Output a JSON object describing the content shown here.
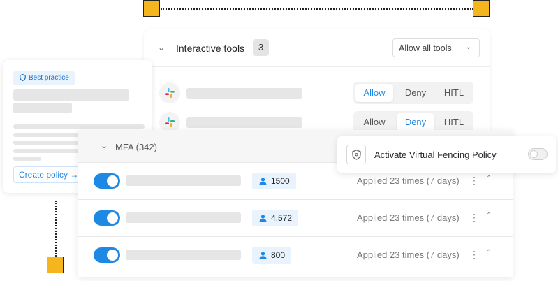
{
  "tools": {
    "title": "Interactive tools",
    "count": "3",
    "policy_select": "Allow all tools",
    "rows": [
      {
        "icon": "slack-icon",
        "options": [
          "Allow",
          "Deny",
          "HITL"
        ],
        "selected": "Allow"
      },
      {
        "icon": "slack-icon",
        "options": [
          "Allow",
          "Deny",
          "HITL"
        ],
        "selected": "Deny"
      }
    ]
  },
  "best_practice": {
    "tag": "Best practice",
    "button": "Create policy →"
  },
  "mfa": {
    "title": "MFA (342)",
    "rows": [
      {
        "enabled": true,
        "users": "1500",
        "applied": "Applied 23 times (7 days)"
      },
      {
        "enabled": true,
        "users": "4,572",
        "applied": "Applied 23 times (7 days)"
      },
      {
        "enabled": true,
        "users": "800",
        "applied": "Applied 23 times (7 days)"
      }
    ]
  },
  "fencing": {
    "label": "Activate Virtual Fencing Policy",
    "enabled": false
  },
  "colors": {
    "accent": "#1e88e5",
    "handle": "#f5b51c",
    "tag_bg": "#e8f3fd"
  }
}
